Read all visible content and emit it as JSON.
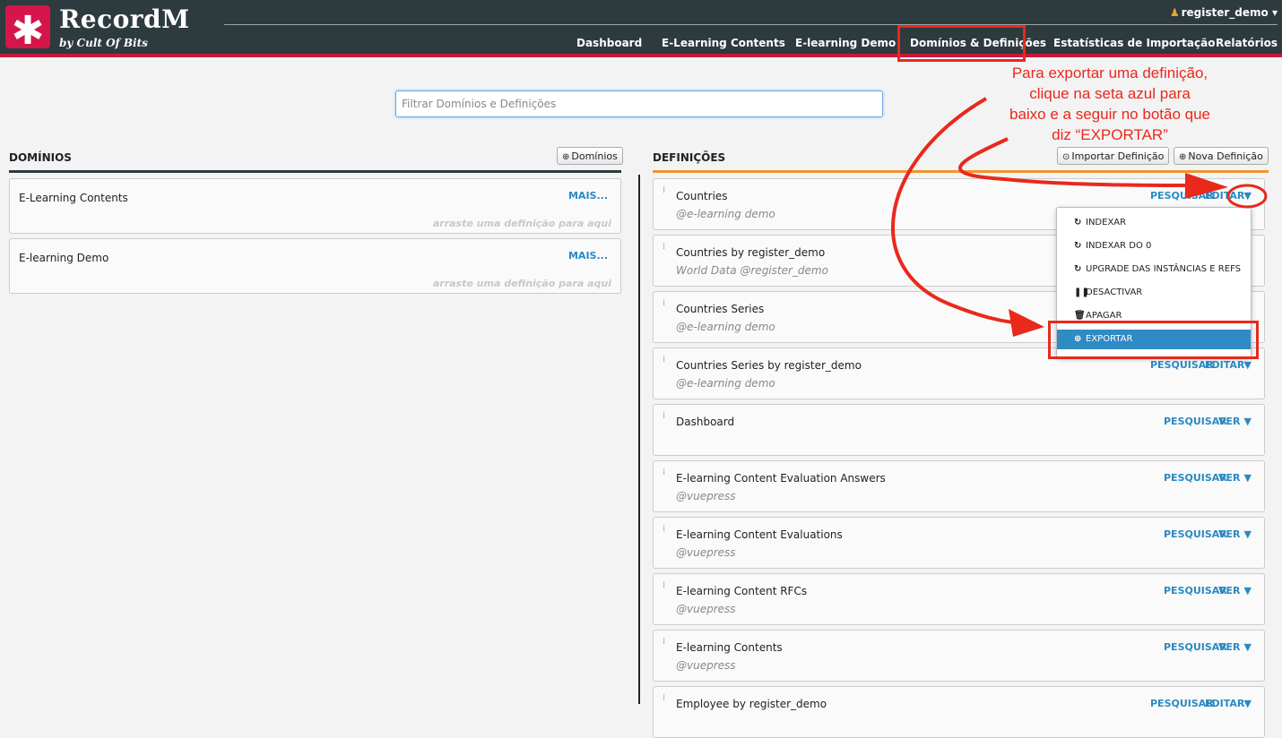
{
  "app": {
    "title": "RecordM",
    "subtitle": "by Cult Of Bits",
    "user": "register_demo"
  },
  "nav": [
    {
      "label": "Dashboard"
    },
    {
      "label": "E-Learning Contents"
    },
    {
      "label": "E-learning Demo"
    },
    {
      "label": "Domínios & Definições"
    },
    {
      "label": "Estatísticas de Importação"
    },
    {
      "label": "Relatórios"
    }
  ],
  "filter": {
    "placeholder": "Filtrar Domínios e Definições",
    "value": ""
  },
  "domains": {
    "title": "DOMÍNIOS",
    "button": "Domínios",
    "items": [
      {
        "name": "E-Learning Contents",
        "more": "MAIS...",
        "hint": "arraste uma definição para aqui"
      },
      {
        "name": "E-learning Demo",
        "more": "MAIS...",
        "hint": "arraste uma definição para aqui"
      }
    ]
  },
  "definitions": {
    "title": "DEFINIÇÕES",
    "import_button": "Importar Definição",
    "new_button": "Nova Definição",
    "search_label": "PESQUISAR",
    "edit_label": "EDITAR",
    "view_label": "VER",
    "items": [
      {
        "name": "Countries",
        "sub": "@e-learning demo"
      },
      {
        "name": "Countries by register_demo",
        "sub": "World Data @register_demo"
      },
      {
        "name": "Countries Series",
        "sub": "@e-learning demo"
      },
      {
        "name": "Countries Series by register_demo",
        "sub": "@e-learning demo"
      },
      {
        "name": "Dashboard",
        "sub": ""
      },
      {
        "name": "E-learning Content Evaluation Answers",
        "sub": "@vuepress"
      },
      {
        "name": "E-learning Content Evaluations",
        "sub": "@vuepress"
      },
      {
        "name": "E-learning Content RFCs",
        "sub": "@vuepress"
      },
      {
        "name": "E-learning Contents",
        "sub": "@vuepress"
      },
      {
        "name": "Employee by register_demo",
        "sub": ""
      }
    ]
  },
  "dropdown": {
    "items": [
      {
        "label": "INDEXAR"
      },
      {
        "label": "INDEXAR DO 0"
      },
      {
        "label": "UPGRADE DAS INSTÂNCIAS E REFS"
      },
      {
        "label": "DESACTIVAR"
      },
      {
        "label": "APAGAR"
      },
      {
        "label": "EXPORTAR"
      }
    ]
  },
  "annotation": {
    "line1": "Para exportar uma definição,",
    "line2": "clique na seta azul para",
    "line3": "baixo e a seguir no botão que",
    "line4": "diz “EXPORTAR”",
    "color": "#e8291c"
  },
  "colors": {
    "header": "#2d3a3e",
    "brand": "#d4164a",
    "link": "#2a8ac2",
    "accent": "#f0952b"
  }
}
